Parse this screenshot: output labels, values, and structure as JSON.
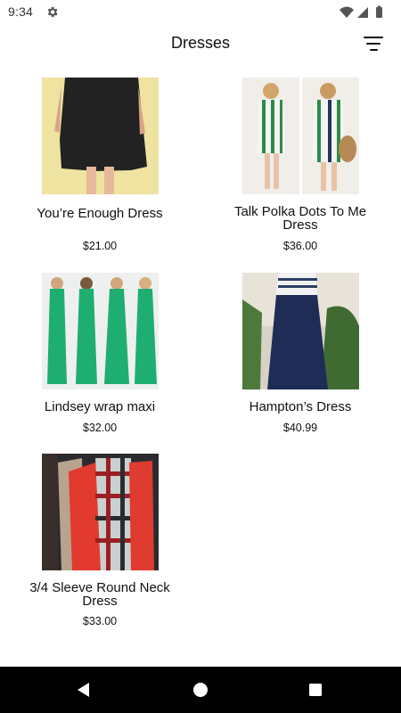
{
  "status": {
    "time": "9:34"
  },
  "header": {
    "title": "Dresses"
  },
  "products": [
    {
      "name": "You’re Enough Dress",
      "price": "$21.00"
    },
    {
      "name": "Talk Polka Dots To Me Dress",
      "price": "$36.00"
    },
    {
      "name": "Lindsey wrap maxi",
      "price": "$32.00"
    },
    {
      "name": "Hampton’s Dress",
      "price": "$40.99"
    },
    {
      "name": "3/4 Sleeve Round Neck Dress",
      "price": "$33.00"
    }
  ],
  "colors": {
    "background": "#ffffff",
    "nav_bar": "#000000",
    "text": "#111111"
  }
}
